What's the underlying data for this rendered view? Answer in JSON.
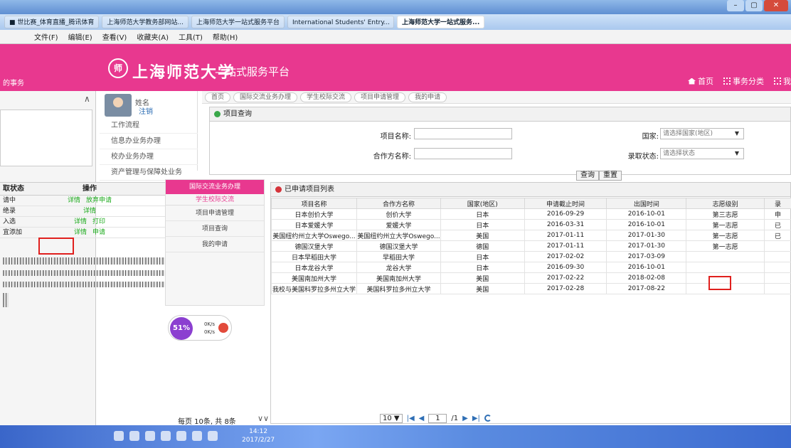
{
  "browser": {
    "tabs": [
      {
        "label": "■ 世比赛_体育直播_腾讯体育",
        "active": false
      },
      {
        "label": "上海师范大学教务部网站...",
        "active": false
      },
      {
        "label": "上海师范大学一站式服务平台",
        "active": false
      },
      {
        "label": "International Students' Entry...",
        "active": false
      },
      {
        "label": "上海师范大学一站式服务...",
        "active": true
      }
    ],
    "window_buttons": {
      "minimize": "–",
      "maximize": "▢",
      "close": "✕"
    },
    "menu": [
      "文件(F)",
      "编辑(E)",
      "查看(V)",
      "收藏夹(A)",
      "工具(T)",
      "帮助(H)"
    ]
  },
  "header": {
    "left_label": "的事务",
    "logo_text": "师",
    "university": "上海师范大学",
    "platform": "—站式服务平台",
    "nav": {
      "home": "首页",
      "category": "事务分类",
      "mine": "我"
    },
    "brand_color": "#e8388f"
  },
  "user": {
    "name": "姓名",
    "logout": "注销"
  },
  "nav_items": [
    "工作流程",
    "信息办业务办理",
    "校办业务办理",
    "资产管理与保障处业务"
  ],
  "crumbs": [
    "首页",
    "国际交流业务办理",
    "学生校际交流",
    "项目申请管理",
    "我的申请"
  ],
  "query": {
    "title": "项目查询",
    "project_label": "项目名称:",
    "partner_label": "合作方名称:",
    "country_label": "国家:",
    "country_placeholder": "请选择国家(地区)",
    "status_label": "录取状态:",
    "status_placeholder": "请选择状态",
    "search_button": "查询",
    "reset_button": "重置"
  },
  "submenu": {
    "head": "国际交流业务办理",
    "sub": "学生校际交流",
    "items": [
      "项目申请管理",
      "项目查询",
      "我的申请"
    ]
  },
  "left_table": {
    "headers": [
      "取状态",
      "操作"
    ],
    "rows": [
      {
        "status": "请中",
        "op1": "详情",
        "op2": "放弃申请"
      },
      {
        "status": "绝录",
        "op1": "详情",
        "op2": ""
      },
      {
        "status": "入选",
        "op1": "详情",
        "op2": "打印"
      },
      {
        "status": "宜添加",
        "op1": "详情",
        "op2": "申请"
      }
    ],
    "pager": "每页 10条, 共 8条"
  },
  "results": {
    "title": "已申请项目列表",
    "headers": [
      "项目名称",
      "合作方名称",
      "国家(地区)",
      "申请截止时间",
      "出国时间",
      "志愿级别",
      "录"
    ],
    "rows": [
      [
        "日本创价大学",
        "创价大学",
        "日本",
        "2016-09-29",
        "2016-10-01",
        "第三志愿",
        "申"
      ],
      [
        "日本爱媛大学",
        "爱媛大学",
        "日本",
        "2016-03-31",
        "2016-10-01",
        "第一志愿",
        "已"
      ],
      [
        "美国纽约州立大学Oswego...",
        "美国纽约州立大学Oswego...",
        "美国",
        "2017-01-11",
        "2017-01-30",
        "第一志愿",
        "已"
      ],
      [
        "德国汉堡大学",
        "德国汉堡大学",
        "德国",
        "2017-01-11",
        "2017-01-30",
        "第一志愿",
        ""
      ],
      [
        "日本早稻田大学",
        "早稻田大学",
        "日本",
        "2017-02-02",
        "2017-03-09",
        "",
        ""
      ],
      [
        "日本龙谷大学",
        "龙谷大学",
        "日本",
        "2016-09-30",
        "2016-10-01",
        "",
        ""
      ],
      [
        "美国南加州大学",
        "美国南加州大学",
        "美国",
        "2017-02-22",
        "2018-02-08",
        "",
        ""
      ],
      [
        "我校与美国科罗拉多州立大学",
        "美国科罗拉多州立大学",
        "美国",
        "2017-02-28",
        "2017-08-22",
        "",
        ""
      ]
    ]
  },
  "pager": {
    "page_size": "10",
    "current": "1",
    "total": "/1"
  },
  "speed_widget": {
    "percent": "51%",
    "up": "0K/s",
    "down": "0K/s"
  },
  "taskbar": {
    "time": "14:12",
    "date": "2017/2/27"
  }
}
